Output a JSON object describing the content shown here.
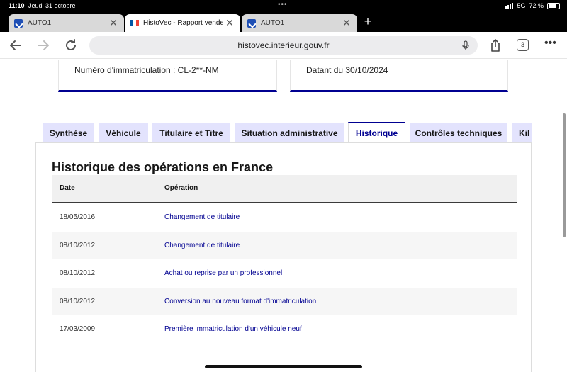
{
  "status_bar": {
    "time": "11:10",
    "date": "Jeudi 31 octobre",
    "network": "5G",
    "battery": "72 %"
  },
  "browser_tabs": [
    {
      "label": "AUTO1",
      "favicon": "auto1-icon",
      "active": false
    },
    {
      "label": "HistoVec - Rapport vendeur",
      "favicon": "french-flag-icon",
      "active": true
    },
    {
      "label": "AUTO1",
      "favicon": "auto1-icon",
      "active": false
    }
  ],
  "address_bar": {
    "url": "histovec.interieur.gouv.fr",
    "tab_count": "3"
  },
  "vehicle_info": {
    "registration": "Numéro d'immatriculation : CL-2**-NM",
    "dated": "Datant du 30/10/2024"
  },
  "page_tabs": [
    {
      "label": "Synthèse",
      "active": false
    },
    {
      "label": "Véhicule",
      "active": false
    },
    {
      "label": "Titulaire et Titre",
      "active": false
    },
    {
      "label": "Situation administrative",
      "active": false
    },
    {
      "label": "Historique",
      "active": true
    },
    {
      "label": "Contrôles techniques",
      "active": false
    },
    {
      "label": "Kil",
      "active": false
    }
  ],
  "history": {
    "title": "Historique des opérations en France",
    "columns": {
      "date": "Date",
      "operation": "Opération"
    },
    "rows": [
      {
        "date": "18/05/2016",
        "operation": "Changement de titulaire"
      },
      {
        "date": "08/10/2012",
        "operation": "Changement de titulaire"
      },
      {
        "date": "08/10/2012",
        "operation": "Achat ou reprise par un professionnel"
      },
      {
        "date": "08/10/2012",
        "operation": "Conversion au nouveau format d'immatriculation"
      },
      {
        "date": "17/03/2009",
        "operation": "Première immatriculation d'un véhicule neuf"
      }
    ]
  },
  "colors": {
    "accent_blue": "#000091",
    "tab_inactive_bg": "#e3e3fd"
  }
}
